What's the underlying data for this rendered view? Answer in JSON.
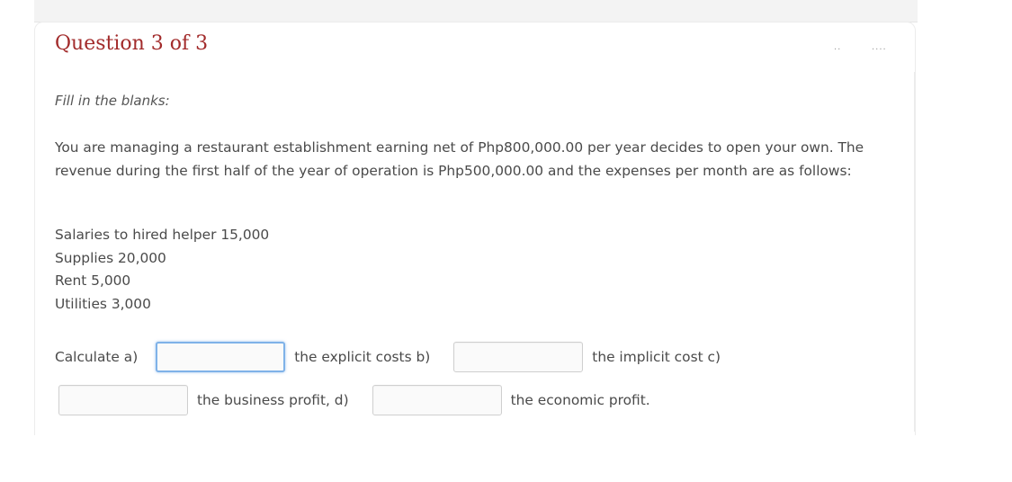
{
  "question": {
    "title": "Question 3 of 3",
    "header_marks": [
      "..",
      "...."
    ],
    "instruction": "Fill in the blanks:",
    "paragraph": "You are managing a restaurant establishment earning net of Php800,000.00 per year decides to open your own. The revenue during the first half of the year of operation is Php500,000.00 and the expenses per month are as follows:",
    "expenses": [
      "Salaries to hired helper 15,000",
      "Supplies 20,000",
      "Rent 5,000",
      "Utilities 3,000"
    ],
    "fill_in": {
      "prefix": "Calculate a)",
      "label_a": "the explicit costs b)",
      "label_b": "the implicit cost c)",
      "label_c": "the business profit, d)",
      "label_d": "the economic profit.",
      "blanks": [
        {
          "value": "",
          "focused": true
        },
        {
          "value": "",
          "focused": false
        },
        {
          "value": "",
          "focused": false
        },
        {
          "value": "",
          "focused": false
        }
      ]
    }
  },
  "colors": {
    "title": "#a22b2b",
    "text": "#4a4a4a",
    "focus_border": "#7fb2e8"
  }
}
